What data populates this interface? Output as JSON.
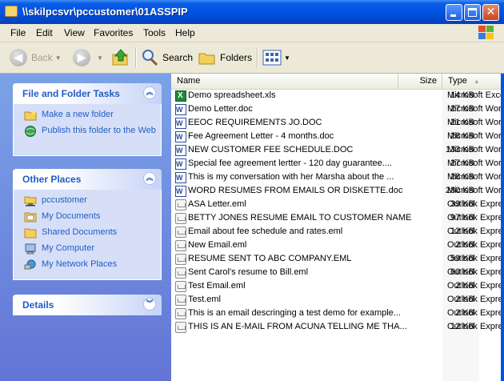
{
  "window": {
    "title": "\\\\skilpcsvr\\pccustomer\\01ASSPIP",
    "close_glyph": "✕"
  },
  "menu": [
    "File",
    "Edit",
    "View",
    "Favorites",
    "Tools",
    "Help"
  ],
  "toolbar": {
    "back": "Back",
    "search": "Search",
    "folders": "Folders"
  },
  "taskpane": {
    "file_tasks": {
      "title": "File and Folder Tasks",
      "items": [
        "Make a new folder",
        "Publish this folder to the Web"
      ]
    },
    "other_places": {
      "title": "Other Places",
      "items": [
        "pccustomer",
        "My Documents",
        "Shared Documents",
        "My Computer",
        "My Network Places"
      ]
    },
    "details": {
      "title": "Details"
    }
  },
  "columns": {
    "name": "Name",
    "size": "Size",
    "type": "Type"
  },
  "files": [
    {
      "name": "Demo spreadsheet.xls",
      "size": "14 KB",
      "type": "Microsoft Excel Worksheet",
      "icon": "excel-icon"
    },
    {
      "name": "Demo Letter.doc",
      "size": "27 KB",
      "type": "Microsoft Word Document",
      "icon": "word-icon"
    },
    {
      "name": "EEOC REQUIREMENTS JO.DOC",
      "size": "21 KB",
      "type": "Microsoft Word Document",
      "icon": "word-icon"
    },
    {
      "name": "Fee Agreement Letter - 4 months.doc",
      "size": "28 KB",
      "type": "Microsoft Word Document",
      "icon": "word-icon"
    },
    {
      "name": "NEW CUSTOMER FEE SCHEDULE.DOC",
      "size": "133 KB",
      "type": "Microsoft Word Document",
      "icon": "word-icon"
    },
    {
      "name": "Special fee agreement lertter - 120 day guarantee....",
      "size": "27 KB",
      "type": "Microsoft Word Document",
      "icon": "word-icon"
    },
    {
      "name": "This is my conversation with her Marsha about the ...",
      "size": "28 KB",
      "type": "Microsoft Word Document",
      "icon": "word-icon"
    },
    {
      "name": "WORD RESUMES FROM EMAILS OR DISKETTE.doc",
      "size": "280 KB",
      "type": "Microsoft Word Document",
      "icon": "word-icon"
    },
    {
      "name": "ASA Letter.eml",
      "size": "39 KB",
      "type": "Outlook Express Mail Message",
      "icon": "email-icon"
    },
    {
      "name": "BETTY JONES RESUME EMAIL TO CUSTOMER NAME...",
      "size": "97 KB",
      "type": "Outlook Express Mail Message",
      "icon": "email-icon"
    },
    {
      "name": "Email about fee schedule and rates.eml",
      "size": "12 KB",
      "type": "Outlook Express Mail Message",
      "icon": "email-icon"
    },
    {
      "name": "New Email.eml",
      "size": "2 KB",
      "type": "Outlook Express Mail Message",
      "icon": "email-icon"
    },
    {
      "name": "RESUME SENT TO ABC COMPANY.EML",
      "size": "59 KB",
      "type": "Outlook Express Mail Message",
      "icon": "email-icon"
    },
    {
      "name": "Sent Carol's resume to Bill.eml",
      "size": "60 KB",
      "type": "Outlook Express Mail Message",
      "icon": "email-icon"
    },
    {
      "name": "Test Email.eml",
      "size": "2 KB",
      "type": "Outlook Express Mail Message",
      "icon": "email-icon"
    },
    {
      "name": "Test.eml",
      "size": "2 KB",
      "type": "Outlook Express Mail Message",
      "icon": "email-icon"
    },
    {
      "name": "This is an email descringing a test demo for example...",
      "size": "2 KB",
      "type": "Outlook Express Mail Message",
      "icon": "email-icon"
    },
    {
      "name": "THIS IS AN E-MAIL FROM ACUNA TELLING ME THA...",
      "size": "12 KB",
      "type": "Outlook Express Mail Message",
      "icon": "email-icon"
    }
  ]
}
